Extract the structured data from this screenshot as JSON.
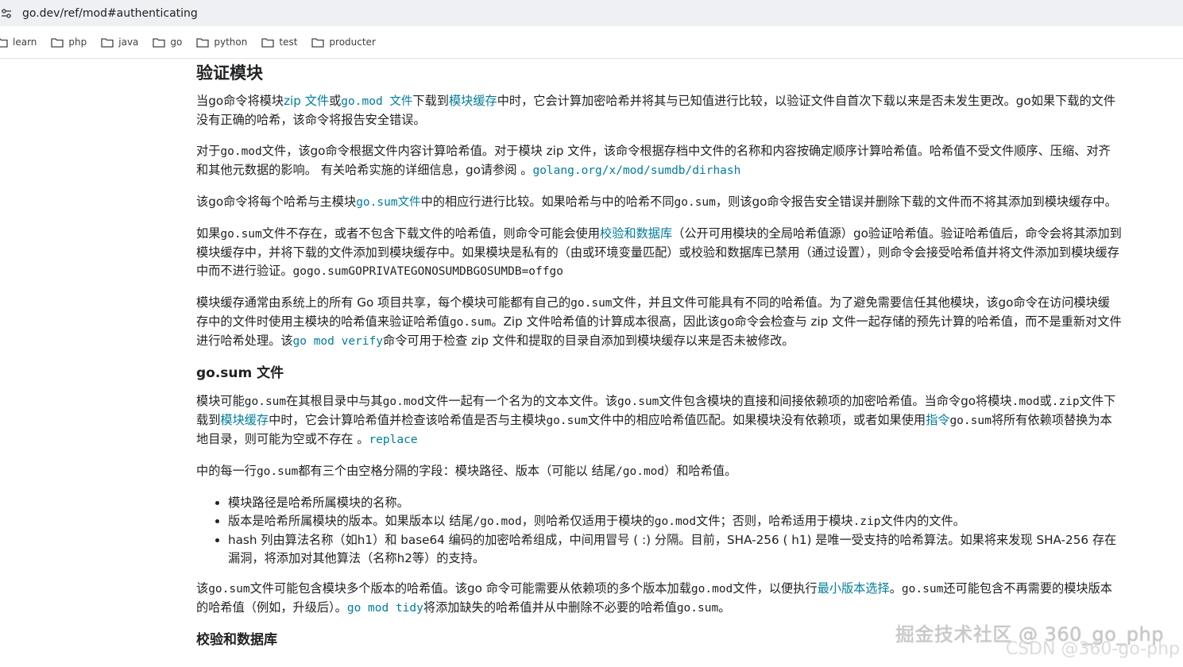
{
  "browser": {
    "url": "go.dev/ref/mod#authenticating",
    "bookmarks": [
      "learn",
      "php",
      "java",
      "go",
      "python",
      "test",
      "producter"
    ]
  },
  "article": {
    "heading": "验证模块",
    "p1": {
      "t1": "当go命令将模块",
      "l1": "zip 文件",
      "t2": "或",
      "l2": "go.mod 文件",
      "t3": "下载到",
      "l3": "模块缓存",
      "t4": "中时，它会计算加密哈希并将其与已知值进行比较，以验证文件自首次下载以来是否未发生更改。go如果下载的文件没有正确的哈希，该命令将报告安全错误。"
    },
    "p2": {
      "t1": "对于",
      "c1": "go.mod",
      "t2": "文件，该go命令根据文件内容计算哈希值。对于模块 zip 文件，该命令根据存档中文件的名称和内容按确定顺序计算哈希值。哈希值不受文件顺序、压缩、对齐和其他元数据的影响。 有关哈希实施的详细信息，go请参阅 。",
      "l1": "golang.org/x/mod/sumdb/dirhash"
    },
    "p3": {
      "t1": "该go命令将每个哈希与主模块",
      "l1": "go.sum文件",
      "t2": "中的相应行进行比较。如果哈希与中的哈希不同",
      "c1": "go.sum",
      "t3": "，则该go命令报告安全错误并删除下载的文件而不将其添加到模块缓存中。"
    },
    "p4": {
      "t1": "如果",
      "c1": "go.sum",
      "t2": "文件不存在，或者不包含下载文件的哈希值，则命令可能会使用",
      "l1": "校验和数据库",
      "t3": "（公开可用模块的全局哈希值源）go验证哈希值。验证哈希值后，命令会将其添加到模块缓存中，并将下载的文件添加到模块缓存中。如果模块是私有的（由或环境变量匹配）或校验和数据库已禁用（通过设置），则命令会接受哈希值并将文件添加到模块缓存中而不进行验证。",
      "c2": "gogo.sumGOPRIVATEGONOSUMDBGOSUMDB=offgo"
    },
    "p5": {
      "t1": "模块缓存通常由系统上的所有 Go 项目共享，每个模块可能都有自己的",
      "c1": "go.sum",
      "t2": "文件，并且文件可能具有不同的哈希值。为了避免需要信任其他模块，该go命令在访问模块缓存中的文件时使用主模块的哈希值来验证哈希值",
      "c2": "go.sum",
      "t3": "。Zip 文件哈希值的计算成本很高，因此该go命令会检查与 zip 文件一起存储的预先计算的哈希值，而不是重新对文件进行哈希处理。该",
      "l1": "go mod verify",
      "t4": "命令可用于检查 zip 文件和提取的目录自添加到模块缓存以来是否未被修改。"
    },
    "section_heading": "go.sum 文件",
    "p6": {
      "t1": "模块可能",
      "c1": "go.sum",
      "t2": "在其根目录中与其",
      "c2": "go.mod",
      "t3": "文件一起有一个名为的文本文件。该",
      "c3": "go.sum",
      "t4": "文件包含模块的直接和间接依赖项的加密哈希值。当命令go将模块",
      "c4": ".mod",
      "t5": "或",
      "c5": ".zip",
      "t6": "文件下载到",
      "l1": "模块缓存",
      "t7": "中时，它会计算哈希值并检查该哈希值是否与主模块",
      "c6": "go.sum",
      "t8": "文件中的相应哈希值匹配。如果模块没有依赖项，或者如果使用",
      "l2": "指令",
      "c7": "go.sum",
      "t9": "将所有依赖项替换为本地目录，则可能为空或不存在 。",
      "l3": "replace"
    },
    "p7": {
      "t1": "中的每一行",
      "c1": "go.sum",
      "t2": "都有三个由空格分隔的字段：模块路径、版本（可能以 结尾",
      "c2": "/go.mod",
      "t3": "）和哈希值。"
    },
    "list": {
      "i1": "模块路径是哈希所属模块的名称。",
      "i2_t1": "版本是哈希所属模块的版本。如果版本以 结尾",
      "i2_c1": "/go.mod",
      "i2_t2": "，则哈希仅适用于模块的",
      "i2_c2": "go.mod",
      "i2_t3": "文件；否则，哈希适用于模块",
      "i2_c3": ".zip",
      "i2_t4": "文件内的文件。",
      "i3": "hash 列由算法名称（如h1）和 base64 编码的加密哈希组成，中间用冒号 ( :) 分隔。目前，SHA-256 ( h1) 是唯一受支持的哈希算法。如果将来发现 SHA-256 存在漏洞，将添加对其他算法（名称h2等）的支持。"
    },
    "p8": {
      "t1": "该",
      "c1": "go.sum",
      "t2": "文件可能包含模块多个版本的哈希值。该go 命令可能需要从依赖项的多个版本加载",
      "c2": "go.mod",
      "t3": "文件，以便执行",
      "l1": "最小版本选择",
      "t4": "。",
      "c3": "go.sum",
      "t5": "还可能包含不再需要的模块版本的哈希值（例如，升级后）。",
      "l2": "go mod tidy",
      "t6": "将添加缺失的哈希值并从中删除不必要的哈希值",
      "c4": "go.sum",
      "t7": "。"
    },
    "bottom_heading": "校验和数据库"
  },
  "watermark": {
    "line1": "掘金技术社区 @ 360_go_php",
    "line2": "CSDN @360-go-php"
  }
}
